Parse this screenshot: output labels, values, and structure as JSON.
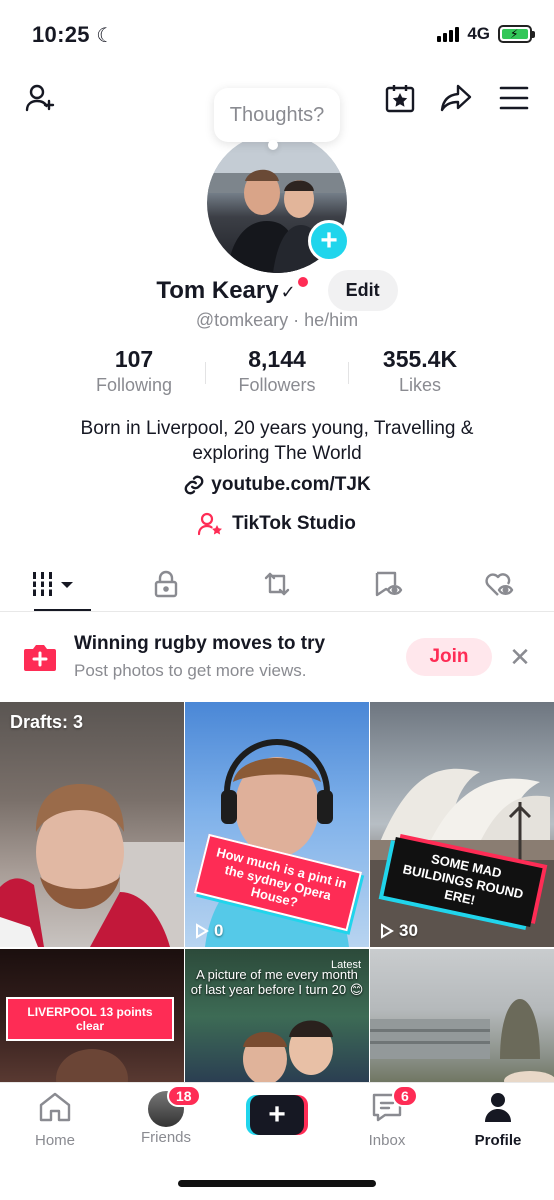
{
  "status_bar": {
    "time": "10:25",
    "network": "4G"
  },
  "header": {
    "thoughts_placeholder": "Thoughts?"
  },
  "profile": {
    "name": "Tom Keary",
    "handle": "@tomkeary · he/him",
    "edit_label": "Edit",
    "stats": [
      {
        "value": "107",
        "label": "Following"
      },
      {
        "value": "8,144",
        "label": "Followers"
      },
      {
        "value": "355.4K",
        "label": "Likes"
      }
    ],
    "bio": "Born in Liverpool, 20 years young, Travelling & exploring The World",
    "link": "youtube.com/TJK",
    "studio_label": "TikTok Studio"
  },
  "tabs": [
    "videos-grid",
    "private",
    "reposts",
    "favorites",
    "liked"
  ],
  "promo": {
    "title": "Winning rugby moves to try",
    "subtitle": "Post photos to get more views.",
    "join_label": "Join"
  },
  "grid": [
    {
      "label": "Drafts: 3",
      "caption": "",
      "views": ""
    },
    {
      "label": "",
      "caption": "How much is a pint in the sydney Opera House?",
      "views": "0"
    },
    {
      "label": "",
      "caption": "SOME MAD BUILDINGS ROUND ERE!",
      "views": "30"
    },
    {
      "label": "",
      "caption": "LIVERPOOL 13 points clear",
      "views": ""
    },
    {
      "label": "Latest",
      "caption": "A picture of me every month of last year before I turn 20 😊",
      "views": ""
    },
    {
      "label": "",
      "caption": "",
      "views": ""
    }
  ],
  "bottom_nav": {
    "home": "Home",
    "friends": "Friends",
    "friends_badge": "18",
    "inbox": "Inbox",
    "inbox_badge": "6",
    "profile": "Profile"
  },
  "colors": {
    "brand_red": "#fe2c55",
    "brand_cyan": "#20d5ec",
    "battery_green": "#34c759"
  }
}
